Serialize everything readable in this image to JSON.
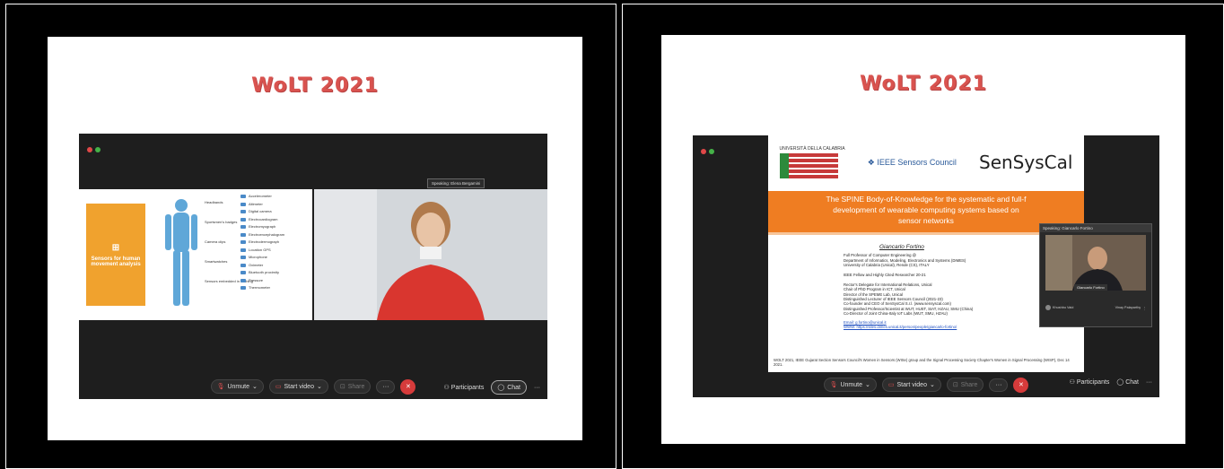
{
  "left": {
    "slide_title": "WoLT 2021",
    "orange_box_label": "Sensors for human movement analysis",
    "sensor_groups": [
      "Headbands",
      "Sportsmen's badges",
      "Camera clips",
      "Smartwatches",
      "Sensors embedded in clothing"
    ],
    "sensors": [
      "Accelerometer",
      "Altimeter",
      "Digital camera",
      "Electrocardiogram",
      "Electromyograph",
      "Electroencephalogram",
      "Electrodermograph",
      "Location GPS",
      "Microphone",
      "Oximeter",
      "Bluetooth proximity",
      "Pressure",
      "Thermometer"
    ],
    "speaking": "Speaking: Elena Bergamini",
    "toolbar": {
      "unmute": "Unmute",
      "start_video": "Start video",
      "share": "Share",
      "participants": "Participants",
      "chat": "Chat"
    }
  },
  "right": {
    "slide_title": "WoLT 2021",
    "university": "UNIVERSITÀ DELLA CALABRIA",
    "ieee": "IEEE Sensors Council",
    "sensyscal": "SenSysCal",
    "banner_lines": [
      "The SPINE Body-of-Knowledge for the systematic and full-f",
      "development of wearable computing systems based on",
      "sensor networks"
    ],
    "speaker_name": "Giancarlo Fortino",
    "details": [
      "Full Professor of Computer Engineering @",
      "Department of Informatics, Modeling, Electronics and Systems (DIMES)",
      "University of Calabria (Unical), Rende (CS), ITALY",
      "",
      "IEEE Fellow and Highly Cited Researcher 20-21",
      "",
      "Rector's Delegate for International Relations, Unical",
      "Chair of PhD Program in ICT, Unical",
      "Director of the SPEME Lab, Unical",
      "Distinguished Lecturer of IEEE Sensors Council (2021-23)",
      "Co-founder and CEO of SenSysCal S.r.l. (www.sensyscal.com)",
      "Distinguished Professor/Scientist at WUT, HUST, SIAT, HZAU, SMU (China)",
      "Co-Director of Joint China-Italy IoT Labs (WUT, SMU, HZAU)"
    ],
    "email": "Email: g.fortino@unical.it",
    "www": "WWW: https://sites.dimes.unical.it/person/people/giancarlo-fortino/",
    "footer": "WOLT 2021, IEEE Gujarat Section Sensors Council's Women in Sensors (WISe) group and the Signal Processing Society Chapter's Women in Signal Processing (WISP), Dec 14 2021.",
    "pip_speaking": "Speaking: Giancarlo Fortino",
    "pip_name": "Giancarlo Fortino",
    "pip_p1": "Khushbu Vaid",
    "pip_p2": "Vinay Palaparthy",
    "toolbar": {
      "unmute": "Unmute",
      "start_video": "Start video",
      "share": "Share",
      "participants": "Participants",
      "chat": "Chat"
    }
  }
}
